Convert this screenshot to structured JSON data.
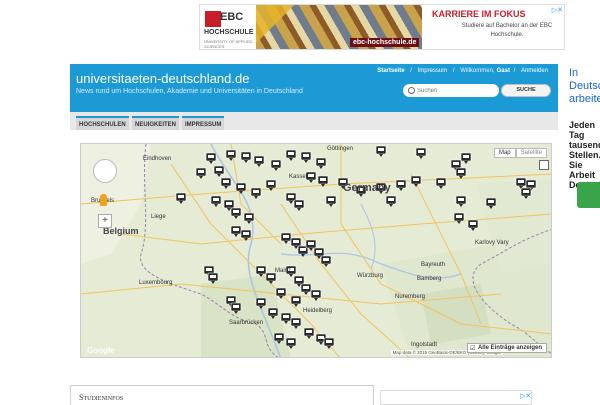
{
  "ad_top": {
    "logo_text": "EBC",
    "logo_sub": "HOCHSCHULE",
    "logo_fine": "UNIVERSITY OF APPLIED SCIENCES",
    "url": "ebc-hochschule.de",
    "headline": "KARRIERE IM FOKUS",
    "copy": "Studiere auf Bachelor an der EBC Hochschule.",
    "close_label": "▷✕"
  },
  "side": {
    "heading": "In Deutschland arbeiten",
    "body": "Jeden Tag tausende Stellen. Sie Arbeit Deutschland"
  },
  "site": {
    "title": "universitaeten-deutschland.de",
    "tagline": "News rund um Hochschulen, Akademie und Universitäten in Deutschland"
  },
  "topnav": {
    "items": [
      "Startseite",
      "Impressum"
    ],
    "welcome_prefix": "Willkommen,",
    "user": "Gast",
    "login": "Anmelden",
    "sep": "/"
  },
  "search": {
    "placeholder": "Suchen",
    "button": "SUCHE"
  },
  "navbar": {
    "tabs": [
      "HOCHSCHULEN",
      "NEUIGKEITEN",
      "IMPRESSUM"
    ]
  },
  "map": {
    "type_map": "Map",
    "type_sat": "Satellite",
    "country_de": "Germany",
    "country_be": "Belgium",
    "cities": [
      "Eindhoven",
      "Brussels",
      "Liege",
      "Luxembourg",
      "Mainz",
      "Würzburg",
      "Bamberg",
      "Bayreuth",
      "Nuremberg",
      "Karlovy Vary",
      "Ingolstadt",
      "Saarbrücken",
      "Heidelberg",
      "Göttingen",
      "Kassel"
    ],
    "attribution": "Map data © 2015 GeoBasis-DE/BKG (©2009), Google",
    "brand": "Google",
    "show_all": "Alle Einträge anzeigen",
    "zoom_in": "+"
  },
  "bottom": {
    "title": "Studieninfos"
  }
}
